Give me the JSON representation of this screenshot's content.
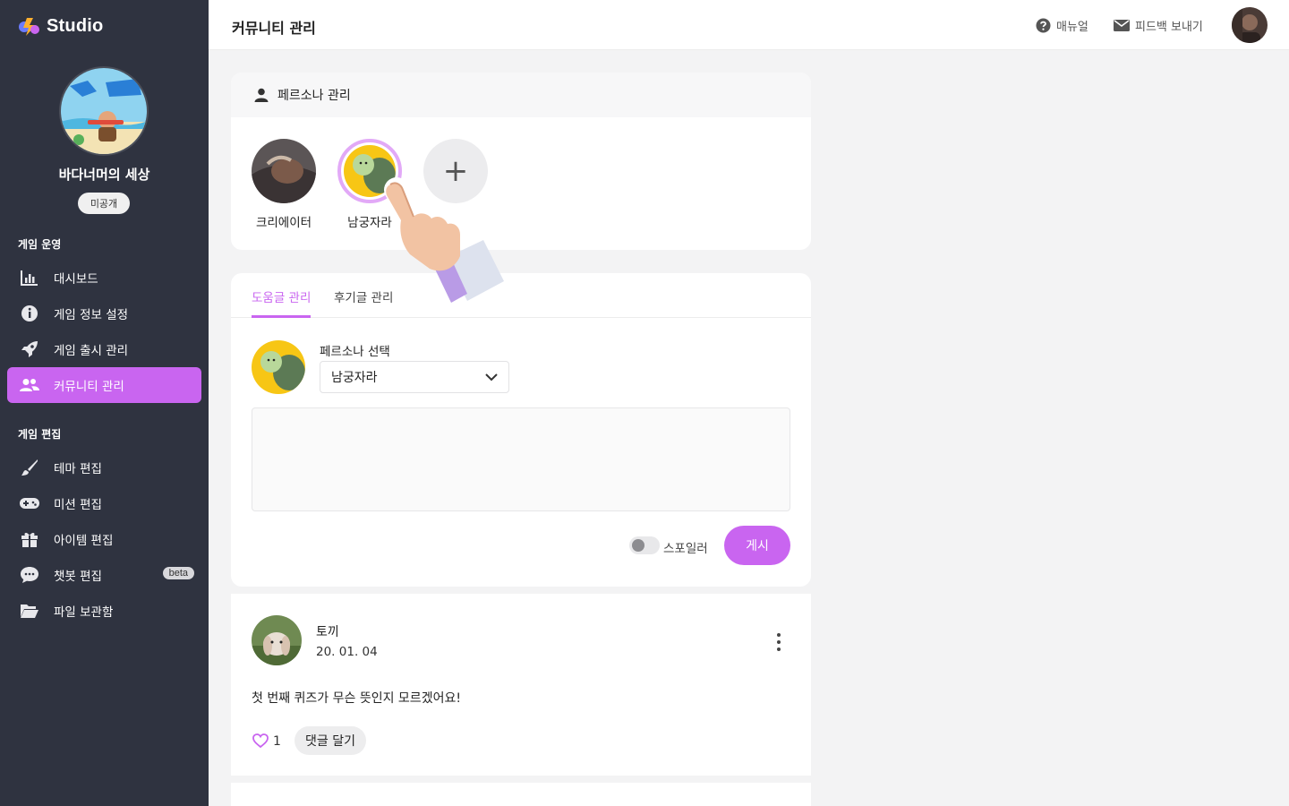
{
  "app": {
    "logo_text": "Studio"
  },
  "sidebar": {
    "game_name": "바다너머의 세상",
    "visibility_badge": "미공개",
    "sections": [
      {
        "title": "게임 운영",
        "items": [
          {
            "label": "대시보드",
            "icon": "bar-chart-icon"
          },
          {
            "label": "게임 정보 설정",
            "icon": "info-icon"
          },
          {
            "label": "게임 출시 관리",
            "icon": "rocket-icon"
          },
          {
            "label": "커뮤니티 관리",
            "icon": "users-icon",
            "active": true
          }
        ]
      },
      {
        "title": "게임 편집",
        "items": [
          {
            "label": "테마 편집",
            "icon": "brush-icon"
          },
          {
            "label": "미션 편집",
            "icon": "gamepad-icon"
          },
          {
            "label": "아이템 편집",
            "icon": "gift-icon"
          },
          {
            "label": "챗봇 편집",
            "icon": "chat-icon",
            "badge": "beta"
          },
          {
            "label": "파일 보관함",
            "icon": "folder-icon"
          }
        ]
      }
    ]
  },
  "topbar": {
    "title": "커뮤니티 관리",
    "manual_label": "매뉴얼",
    "feedback_label": "피드백 보내기"
  },
  "persona_card": {
    "title": "페르소나 관리",
    "personas": [
      {
        "name": "크리에이터"
      },
      {
        "name": "남궁자라",
        "selected": true
      }
    ],
    "add_symbol": "+"
  },
  "board_card": {
    "tabs": [
      {
        "label": "도움글 관리",
        "active": true
      },
      {
        "label": "후기글 관리"
      }
    ],
    "persona_select_label": "페르소나 선택",
    "persona_select_value": "남궁자라",
    "textarea_value": "",
    "spoiler_label": "스포일러",
    "spoiler_on": false,
    "post_button": "게시"
  },
  "post": {
    "author": "토끼",
    "date": "20. 01. 04",
    "body": "첫 번째 퀴즈가 무슨 뜻인지 모르겠어요!",
    "likes": "1",
    "comment_button": "댓글 달기"
  },
  "colors": {
    "accent": "#c965f0",
    "sidebar_bg": "#2f3340"
  }
}
